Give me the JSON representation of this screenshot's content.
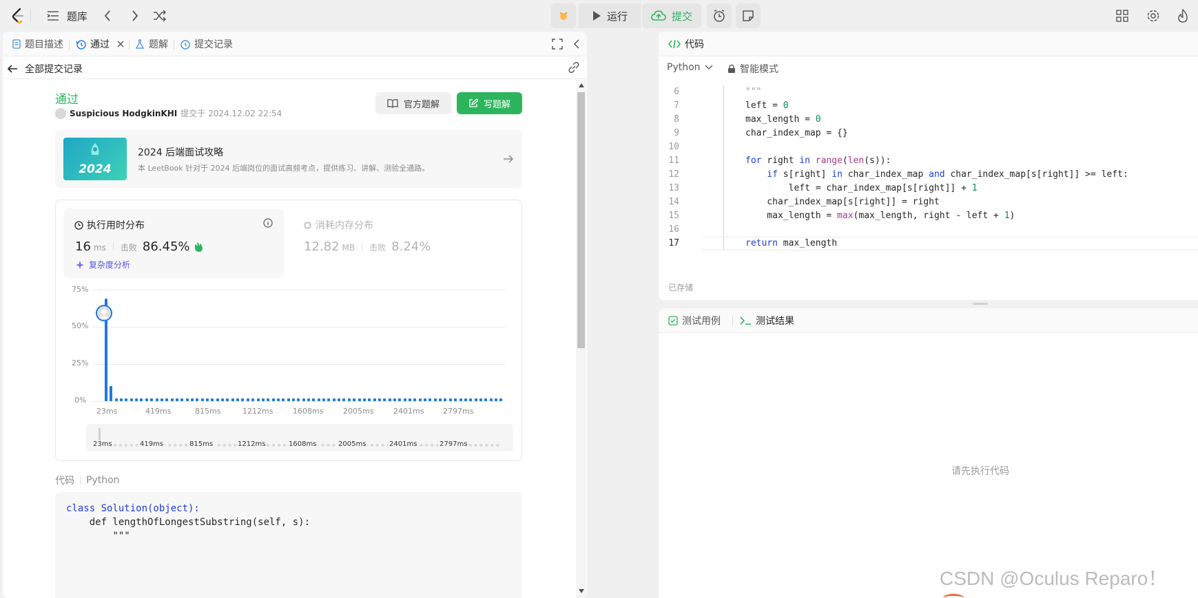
{
  "topbar": {
    "problem_bank": "题库",
    "run": "运行",
    "submit": "提交"
  },
  "left_tabs": [
    {
      "label": "题目描述"
    },
    {
      "label": "通过"
    },
    {
      "label": "题解"
    },
    {
      "label": "提交记录"
    }
  ],
  "back": {
    "label": "全部提交记录"
  },
  "submission": {
    "status": "通过",
    "user": "Suspicious HodgkinKHI",
    "submitted_at": "提交于 2024.12.02 22:54"
  },
  "buttons": {
    "official": "官方题解",
    "write": "写题解"
  },
  "promo": {
    "badge": "2024",
    "title": "2024 后端面试攻略",
    "desc": "本 LeetBook 针对于 2024 后端岗位的面试高频考点，提供练习、讲解、测验全通路。"
  },
  "runtime": {
    "label": "执行用时分布",
    "value": "16",
    "unit": "ms",
    "beats_label": "击败",
    "beats": "86.45%",
    "analysis": "复杂度分析"
  },
  "memory": {
    "label": "消耗内存分布",
    "value": "12.82",
    "unit": "MB",
    "beats_label": "击败",
    "beats": "8.24%"
  },
  "chart_data": {
    "type": "bar",
    "yticks": [
      "75%",
      "50%",
      "25%",
      "0%"
    ],
    "xticks": [
      "23ms",
      "419ms",
      "815ms",
      "1212ms",
      "1608ms",
      "2005ms",
      "2401ms",
      "2797ms"
    ],
    "ylim": [
      0,
      75
    ],
    "bars_percent": [
      69,
      10,
      1.5,
      1.5,
      1.5,
      1.5,
      1.5,
      1.5,
      1.5,
      1.5,
      1.5,
      1.5,
      1.5,
      1.5,
      1.5,
      1.5,
      1.5,
      1.5,
      1.5,
      1.5,
      1.5,
      1.5,
      1.5,
      1.5,
      1.5,
      1.5,
      1.5,
      1.5,
      1.5,
      1.5,
      1.5,
      1.5,
      1.5,
      1.5,
      1.5,
      1.5,
      1.5,
      1.5,
      1.5,
      1.5,
      1.5,
      1.5,
      1.5,
      1.5,
      1.5,
      1.5,
      1.5,
      1.5,
      1.5,
      1.5,
      1.5,
      1.5,
      1.5,
      1.5,
      1.5,
      1.5,
      1.5,
      1.5,
      1.5,
      1.5,
      1.5,
      1.5,
      1.5,
      1.5,
      1.5,
      1.5,
      1.5,
      1.5,
      1.5,
      1.5,
      1.5,
      1.5,
      1.5,
      1.5,
      1.5,
      1.5,
      1.5,
      1.5,
      1.5
    ],
    "grid": true
  },
  "minimap": {
    "ticks": [
      "23ms",
      "419ms",
      "815ms",
      "1212ms",
      "1608ms",
      "2005ms",
      "2401ms",
      "2797ms"
    ]
  },
  "code_section": {
    "label": "代码",
    "lang": "Python",
    "lines": [
      "class Solution(object):",
      "    def lengthOfLongestSubstring(self, s):",
      "        \"\"\""
    ]
  },
  "editor": {
    "title": "代码",
    "lang": "Python",
    "mode": "智能模式",
    "saved": "已存储",
    "line_numbers": [
      "6",
      "7",
      "8",
      "9",
      "10",
      "11",
      "12",
      "13",
      "14",
      "15",
      "16",
      "17"
    ]
  },
  "tests": {
    "tab1": "测试用例",
    "tab2": "测试结果",
    "placeholder": "请先执行代码"
  },
  "watermark": "CSDN @Oculus Reparo！",
  "colors": {
    "accent": "#2db55d",
    "bar": "#1f78e0",
    "brand": "#ffa116"
  }
}
